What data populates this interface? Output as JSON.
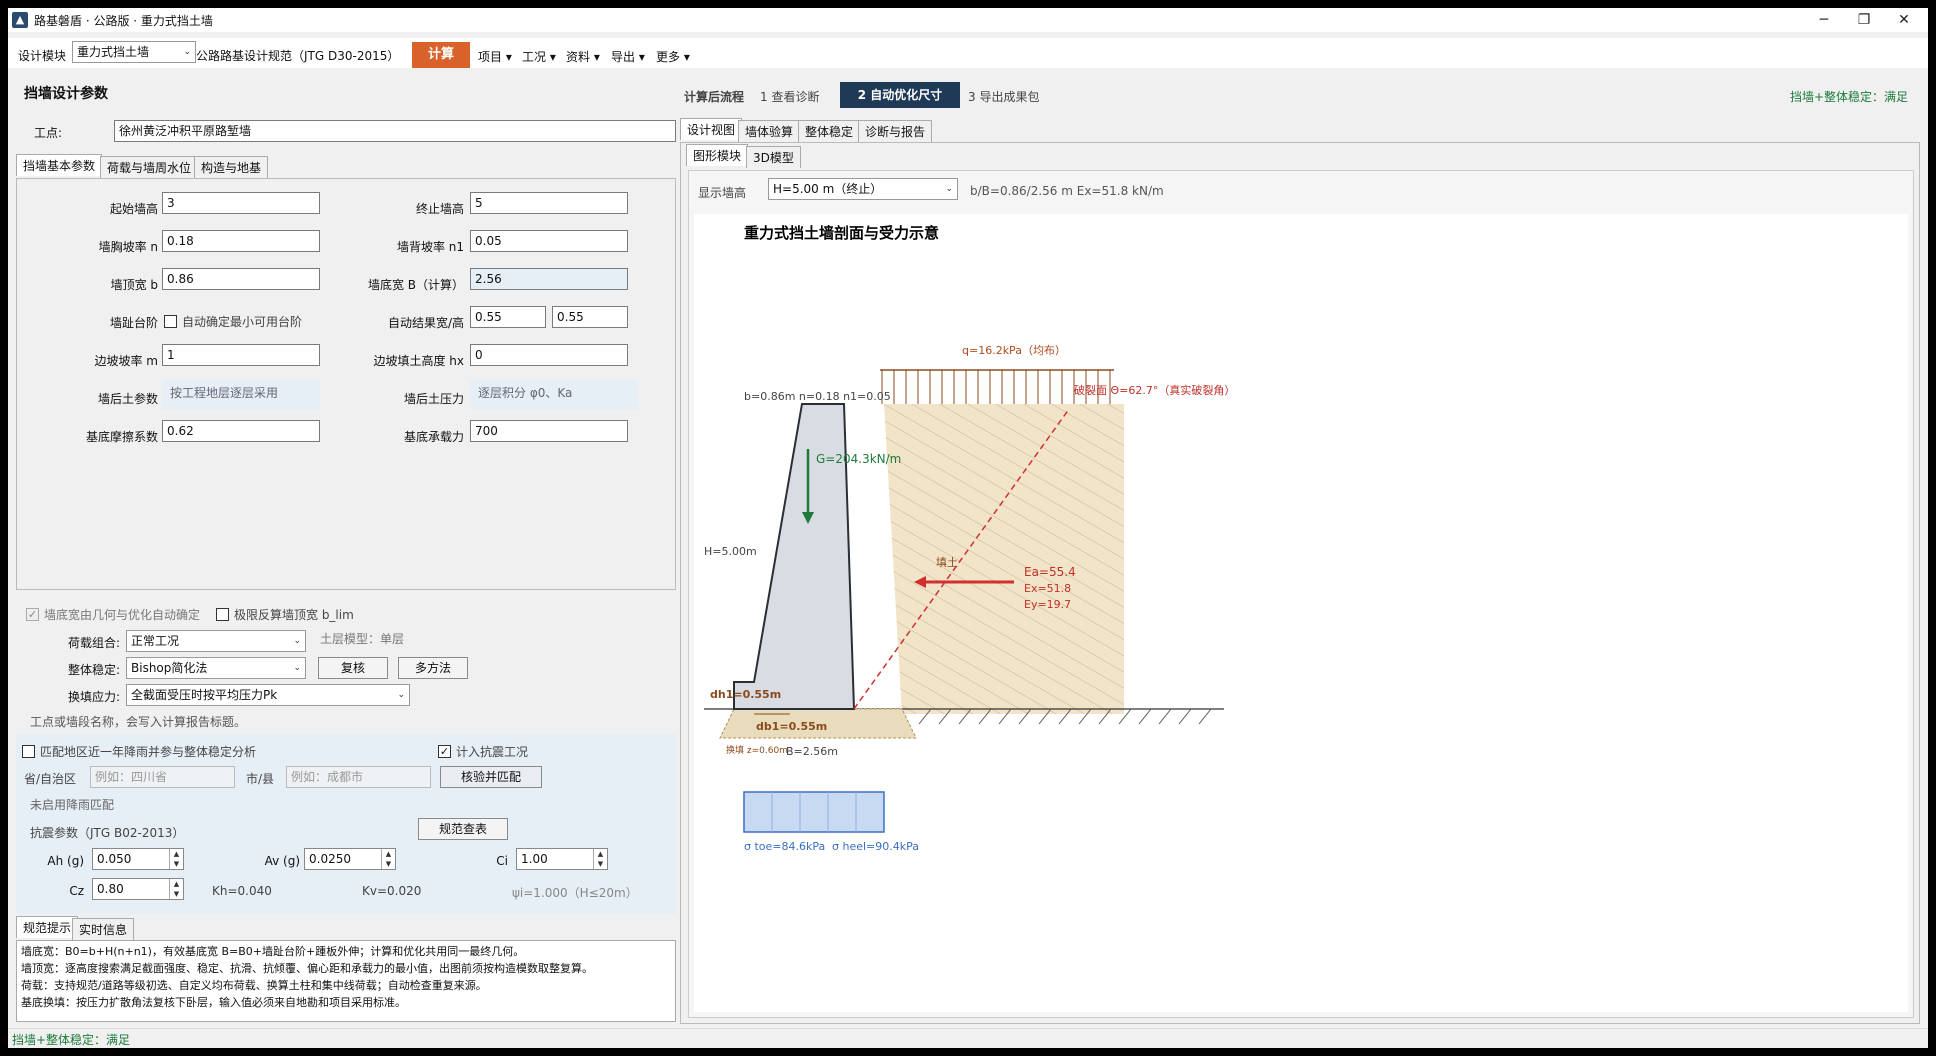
{
  "window": {
    "title": "路基磐盾 · 公路版 · 重力式挡土墙",
    "min": "─",
    "max": "❐",
    "close": "✕"
  },
  "toolbar": {
    "module_label": "设计模块",
    "module_value": "重力式挡土墙",
    "standard": "公路路基设计规范（JTG D30-2015）",
    "calc": "计算",
    "menus": [
      "项目",
      "工况",
      "资料",
      "导出",
      "更多"
    ]
  },
  "left": {
    "section_title": "挡墙设计参数",
    "site_label": "工点:",
    "site_value": "徐州黄泛冲积平原路堑墙",
    "tabs": [
      "挡墙基本参数",
      "荷载与墙周水位",
      "构造与地基"
    ],
    "params": {
      "start_h_label": "起始墙高",
      "start_h": "3",
      "end_h_label": "终止墙高",
      "end_h": "5",
      "front_slope_label": "墙胸坡率 n",
      "front_slope": "0.18",
      "back_slope_label": "墙背坡率 n1",
      "back_slope": "0.05",
      "top_width_label": "墙顶宽 b",
      "top_width": "0.86",
      "base_width_label": "墙底宽 B（计算）",
      "base_width": "2.56",
      "toe_step_label": "墙趾台阶",
      "toe_step_check": "自动确定最小可用台阶",
      "auto_result_label": "自动结果宽/高",
      "auto_w": "0.55",
      "auto_h": "0.55",
      "side_slope_label": "边坡坡率 m",
      "side_slope": "1",
      "fill_h_label": "边坡填土高度 hx",
      "fill_h": "0",
      "soil_label": "墙后土参数",
      "soil_hint": "按工程地层逐层采用",
      "pressure_label": "墙后土压力",
      "pressure_hint": "逐层积分 φ0、Ka",
      "friction_label": "基底摩擦系数",
      "friction": "0.62",
      "bearing_label": "基底承载力",
      "bearing": "700"
    },
    "opts": {
      "auto_base": "墙底宽由几何与优化自动确定",
      "limit_top": "极限反算墙顶宽 b_lim",
      "load_combo_label": "荷载组合:",
      "load_combo": "正常工况",
      "soil_model": "土层模型：单层",
      "stability_label": "整体稳定:",
      "stability": "Bishop简化法",
      "check_btn": "复核",
      "multi_btn": "多方法",
      "stress_label": "换填应力:",
      "stress": "全截面受压时按平均压力Pk",
      "note": "工点或墙段名称，会写入计算报告标题。"
    },
    "rain": {
      "check": "匹配地区近一年降雨并参与整体稳定分析",
      "seismic_check": "计入抗震工况",
      "prov_label": "省/自治区",
      "prov_ph": "例如：四川省",
      "city_label": "市/县",
      "city_ph": "例如：成都市",
      "verify_btn": "核验并匹配",
      "status": "未启用降雨匹配",
      "seis_title": "抗震参数（JTG B02-2013）",
      "table_btn": "规范查表",
      "ah_label": "Ah (g)",
      "ah": "0.050",
      "av_label": "Av (g)",
      "av": "0.0250",
      "ci_label": "Ci",
      "ci": "1.00",
      "cz_label": "Cz",
      "cz": "0.80",
      "kh": "Kh=0.040",
      "kv": "Kv=0.020",
      "psi": "ψi=1.000（H≤20m）"
    },
    "bottom_tabs": [
      "规范提示",
      "实时信息"
    ],
    "hints": [
      "墙底宽：B0=b+H(n+n1)，有效基底宽 B=B0+墙趾台阶+踵板外伸；计算和优化共用同一最终几何。",
      "墙顶宽：逐高度搜索满足截面强度、稳定、抗滑、抗倾覆、偏心距和承载力的最小值，出图前须按构造模数取整复算。",
      "荷载：支持规范/道路等级初选、自定义均布荷载、换算土柱和集中线荷载；自动检查重复来源。",
      "基底换填：按压力扩散角法复核下卧层，输入值必须来自地勘和项目采用标准。"
    ]
  },
  "status_bar": "挡墙+整体稳定：满足",
  "right": {
    "flow_label": "计算后流程",
    "steps": [
      "1  查看诊断",
      "2  自动优化尺寸",
      "3  导出成果包"
    ],
    "status": "挡墙+整体稳定：满足",
    "view_tabs": [
      "设计视图",
      "墙体验算",
      "整体稳定",
      "诊断与报告"
    ],
    "sub_tabs": [
      "图形模块",
      "3D模型"
    ],
    "show_h_label": "显示墙高",
    "show_h_value": "H=5.00 m（终止）",
    "summary": "b/B=0.86/2.56 m    Ex=51.8 kN/m",
    "diagram": {
      "title": "重力式挡土墙剖面与受力示意",
      "q_label": "q=16.2kPa（均布）",
      "fracture_label": "破裂面 Θ=62.7°（真实破裂角）",
      "geom_label": "b=0.86m  n=0.18  n1=0.05",
      "g_label": "G=204.3kN/m",
      "h_label": "H=5.00m",
      "fill_label": "填土",
      "ea_label": "Ea=55.4",
      "ex_label": "Ex=51.8",
      "ey_label": "Ey=19.7",
      "dh1_label": "dh1=0.55m",
      "db1_label": "db1=0.55m",
      "replace_label": "换填 z=0.60m",
      "b_label": "B=2.56m",
      "stress_labels": [
        "σ toe=84.6kPa",
        "σ heel=90.4kPa"
      ]
    }
  }
}
